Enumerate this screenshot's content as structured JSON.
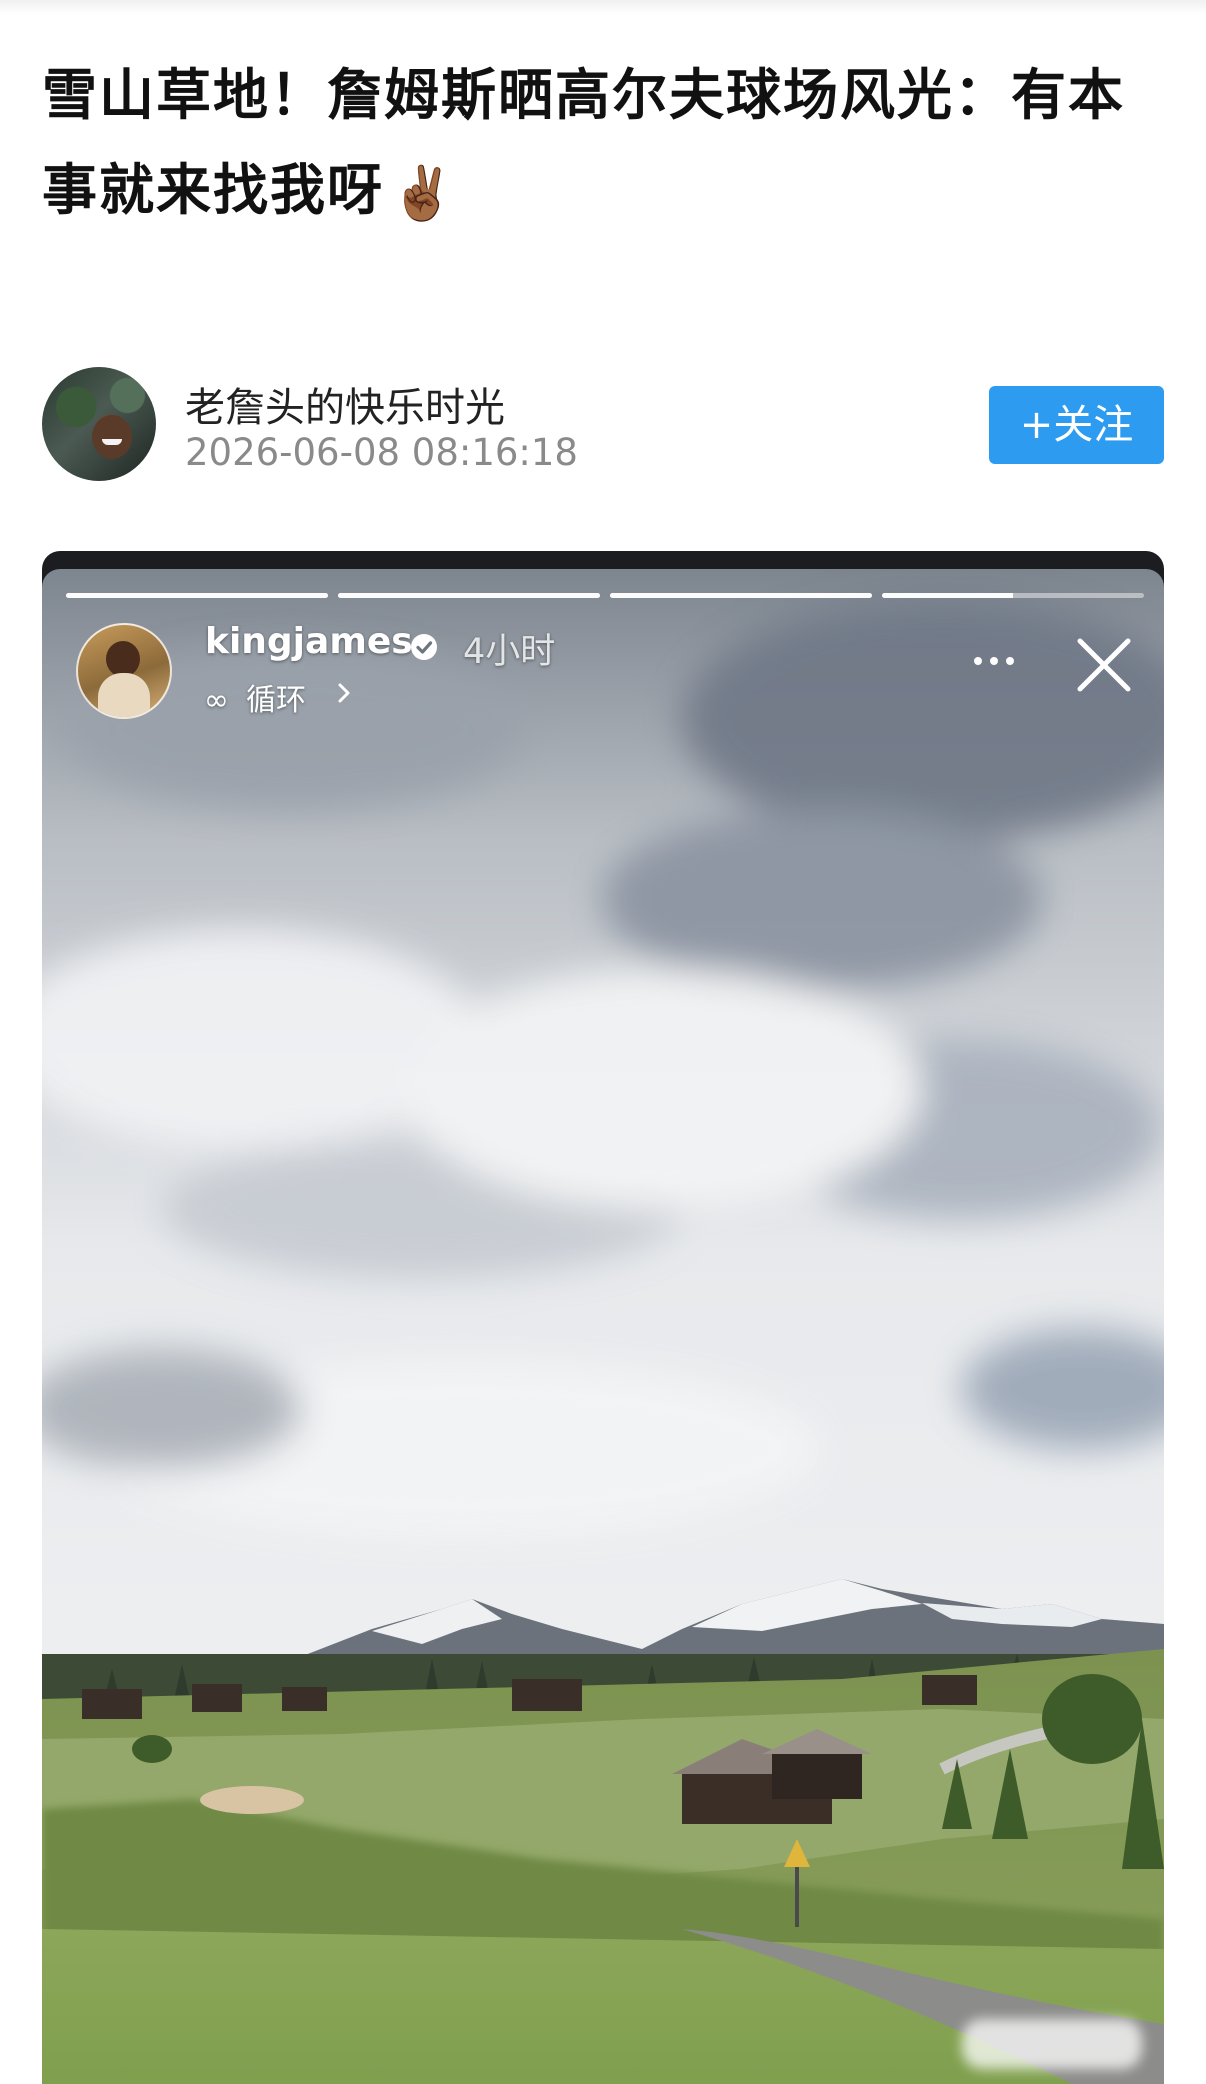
{
  "article": {
    "title": "雪山草地！詹姆斯晒高尔夫球场风光：有本事就来找我呀",
    "title_emoji": "✌🏾"
  },
  "author": {
    "name": "老詹头的快乐时光",
    "timestamp": "2026-06-08 08:16:18",
    "follow_label": "+关注",
    "follow_color": "#2d9cf0"
  },
  "story": {
    "username": "kingjames",
    "time_ago": "4小时",
    "loop_symbol": "∞",
    "loop_label": "循环",
    "progress": [
      1.0,
      1.0,
      1.0,
      0.5
    ],
    "icons": [
      "verified-icon",
      "chevron-right-icon",
      "more-icon",
      "close-icon"
    ]
  }
}
